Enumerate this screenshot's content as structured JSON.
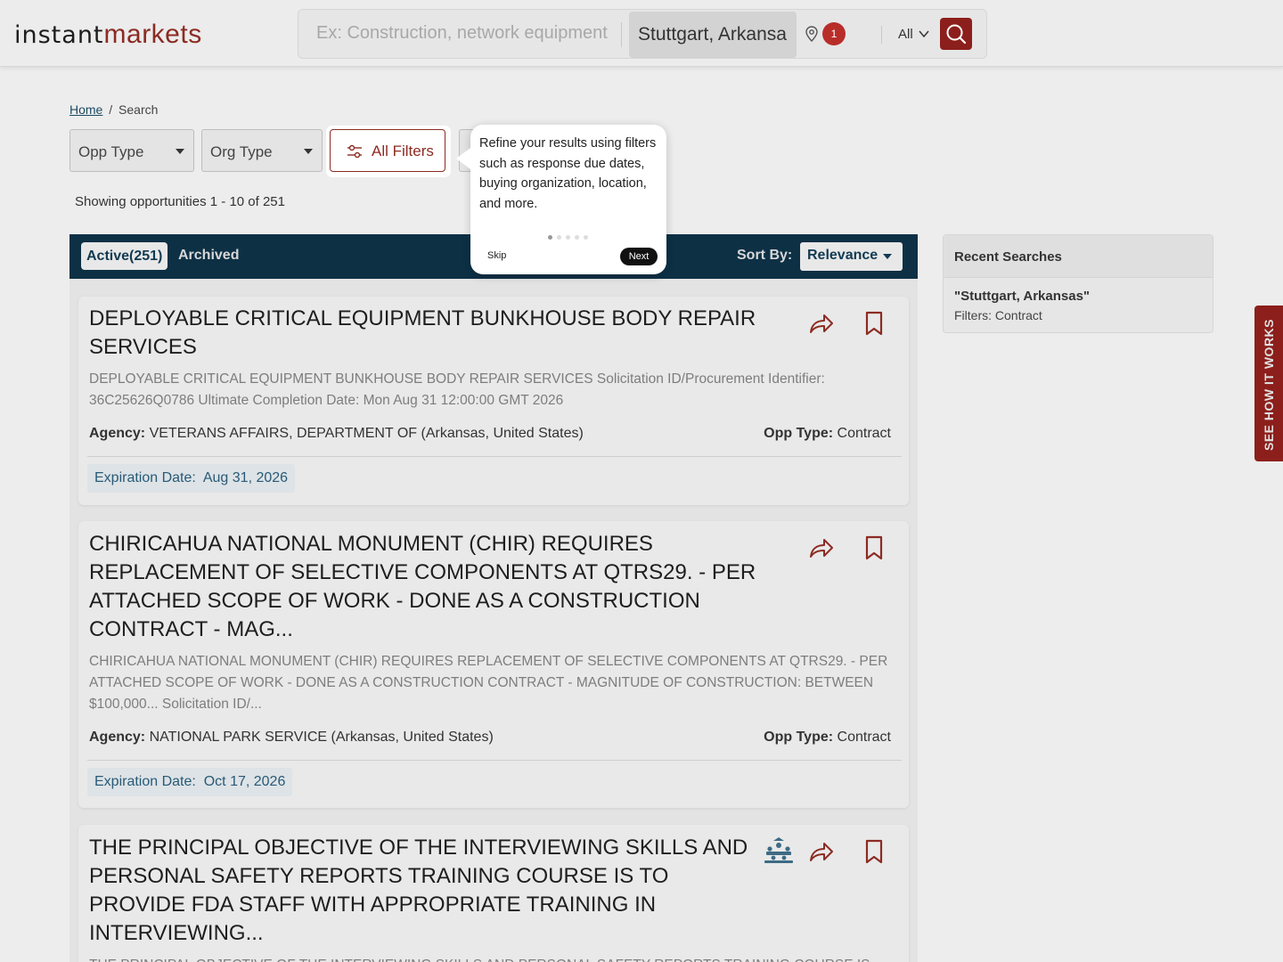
{
  "logo": {
    "part1": "instant",
    "part2": "markets"
  },
  "search": {
    "keyword_placeholder": "Ex: Construction, network equipment",
    "location": "Stuttgart, Arkansa",
    "location_count": "1",
    "scope": "All"
  },
  "breadcrumb": {
    "home": "Home",
    "separator": "/",
    "current": "Search"
  },
  "filters": {
    "opp_type": "Opp Type",
    "org_type": "Org Type",
    "all_filters": "All Filters"
  },
  "showing": "Showing opportunities 1 - 10 of 251",
  "tooltip": {
    "text": "Refine your results using filters such as response due dates, buying organization, location, and more.",
    "skip": "Skip",
    "next": "Next",
    "step": 1,
    "total_steps": 5
  },
  "results": {
    "tab_active": "Active(251)",
    "tab_archived": "Archived",
    "sort_label": "Sort By:",
    "sort_value": "Relevance",
    "items": [
      {
        "title": "DEPLOYABLE CRITICAL EQUIPMENT BUNKHOUSE BODY REPAIR SERVICES",
        "desc": "DEPLOYABLE CRITICAL EQUIPMENT BUNKHOUSE BODY REPAIR SERVICES Solicitation ID/Procurement Identifier: 36C25626Q0786 Ultimate Completion Date: Mon Aug 31 12:00:00 GMT 2026",
        "agency_label": "Agency:",
        "agency": "VETERANS AFFAIRS, DEPARTMENT OF (Arkansas, United States)",
        "opp_type_label": "Opp Type:",
        "opp_type": "Contract",
        "expiration_label": "Expiration Date:",
        "expiration": "Aug 31, 2026"
      },
      {
        "title": "CHIRICAHUA NATIONAL MONUMENT (CHIR) REQUIRES REPLACEMENT OF SELECTIVE COMPONENTS AT QTRS29. - PER ATTACHED SCOPE OF WORK - DONE AS A CONSTRUCTION CONTRACT - MAG...",
        "desc": "CHIRICAHUA NATIONAL MONUMENT (CHIR) REQUIRES REPLACEMENT OF SELECTIVE COMPONENTS AT QTRS29. - PER ATTACHED SCOPE OF WORK - DONE AS A CONSTRUCTION CONTRACT - MAGNITUDE OF CONSTRUCTION: BETWEEN $100,000... Solicitation ID/...",
        "agency_label": "Agency:",
        "agency": "NATIONAL PARK SERVICE (Arkansas, United States)",
        "opp_type_label": "Opp Type:",
        "opp_type": "Contract",
        "expiration_label": "Expiration Date:",
        "expiration": "Oct 17, 2026"
      },
      {
        "title": "THE PRINCIPAL OBJECTIVE OF THE INTERVIEWING SKILLS AND PERSONAL SAFETY REPORTS TRAINING COURSE IS TO PROVIDE FDA STAFF WITH APPROPRIATE TRAINING IN INTERVIEWING...",
        "desc": "THE PRINCIPAL OBJECTIVE OF THE INTERVIEWING SKILLS AND PERSONAL SAFETY REPORTS TRAINING COURSE IS"
      }
    ]
  },
  "recent_searches": {
    "heading": "Recent Searches",
    "query": "\"Stuttgart, Arkansas\"",
    "filters": "Filters: Contract"
  },
  "side_tab": "SEE HOW IT WORKS",
  "colors": {
    "brand": "#8c2b23",
    "navy": "#0d3045",
    "link": "#1c4a63"
  }
}
